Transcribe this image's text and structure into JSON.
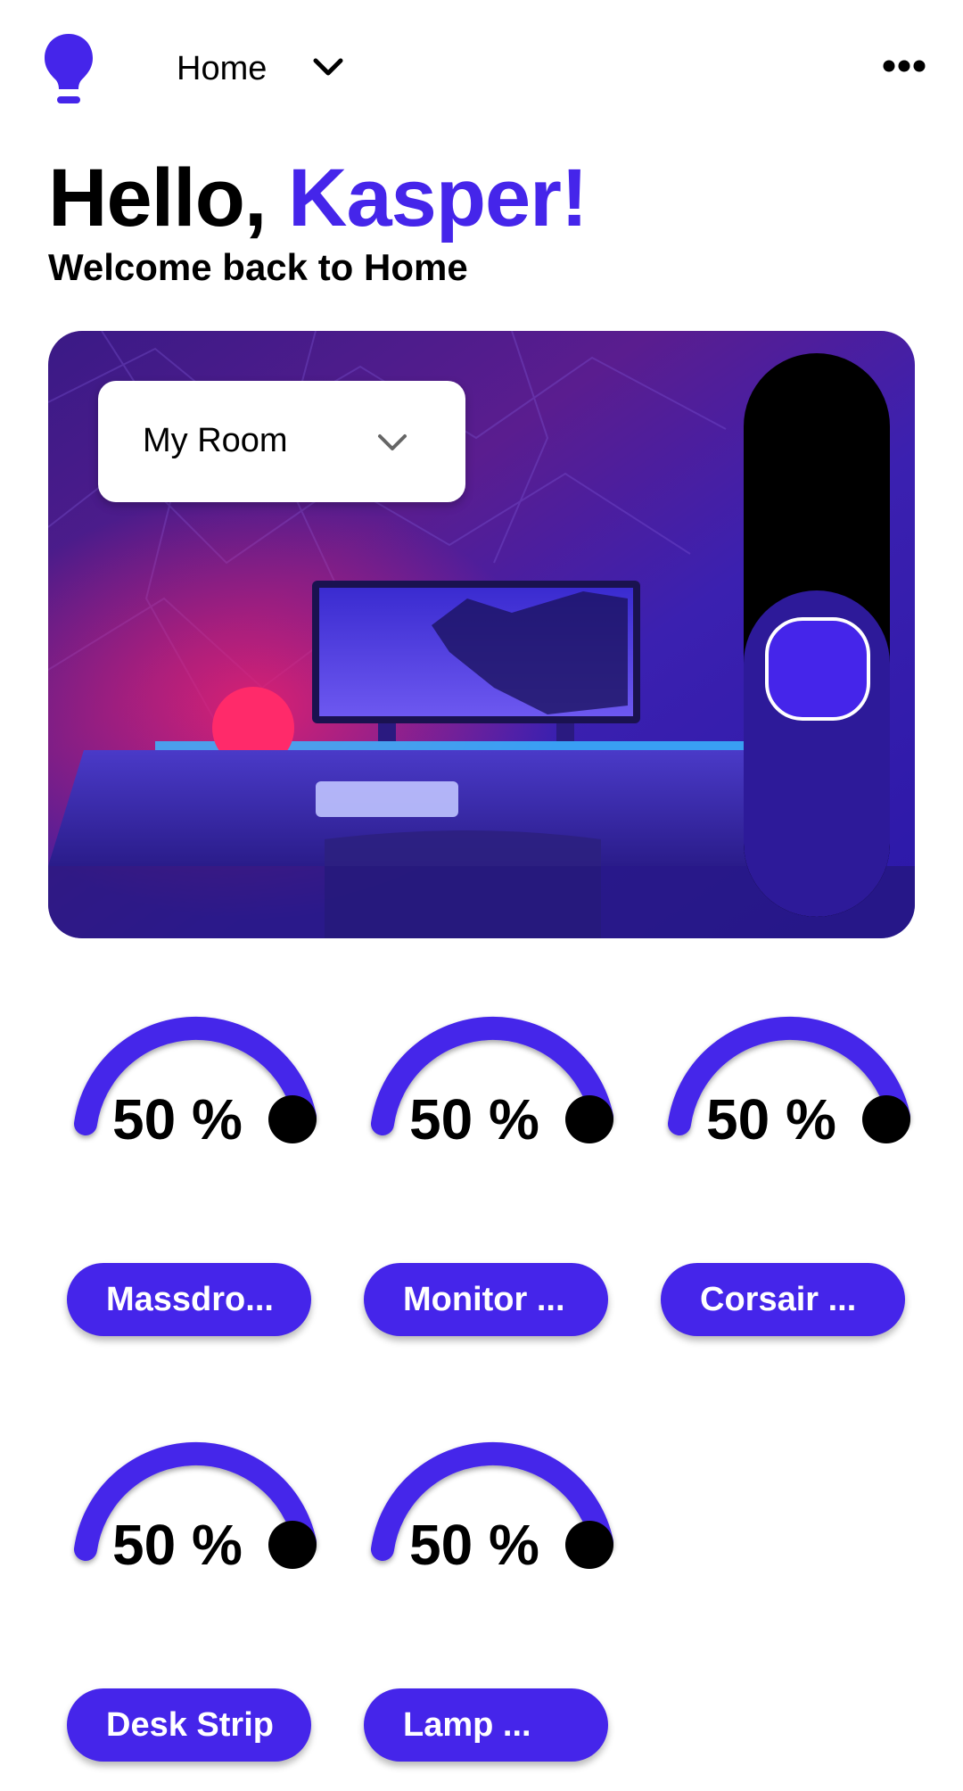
{
  "header": {
    "logo_icon": "lightbulb-icon",
    "home_label": "Home",
    "dropdown_icon": "chevron-down-icon",
    "more_icon": "more-horizontal-icon"
  },
  "greeting": {
    "hello": "Hello, ",
    "name": "Kasper!",
    "subtitle": "Welcome back to Home"
  },
  "room": {
    "selected": "My Room",
    "dropdown_icon": "chevron-down-icon",
    "brightness_level": 0.5
  },
  "devices": [
    {
      "label": "Massdro...",
      "level_text": "50 %"
    },
    {
      "label": "Monitor ...",
      "level_text": "50 %"
    },
    {
      "label": "Corsair ...",
      "level_text": "50 %"
    },
    {
      "label": "Desk Strip",
      "level_text": "50 %"
    },
    {
      "label": "Lamp ...",
      "level_text": "50 %"
    }
  ],
  "colors": {
    "accent": "#4525ea",
    "knob": "#000000",
    "text": "#000000",
    "background": "#ffffff"
  }
}
